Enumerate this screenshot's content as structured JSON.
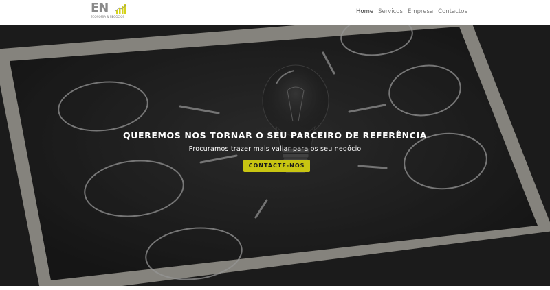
{
  "brand": {
    "logo_text": "EN",
    "logo_tagline": "ECONOMIA & NEGÓCIOS",
    "logo_subtagline": "",
    "colors": {
      "logo_gray": "#8a8a8a",
      "logo_accent": "#d4d21a"
    }
  },
  "nav": {
    "items": [
      {
        "label": "Home",
        "active": true
      },
      {
        "label": "Serviços",
        "active": false
      },
      {
        "label": "Empresa",
        "active": false
      },
      {
        "label": "Contactos",
        "active": false
      }
    ]
  },
  "hero": {
    "headline": "QUEREMOS NOS TORNAR O SEU PARCEIRO DE REFERÊNCIA",
    "subheadline": "Procuramos trazer mais valiar para os seu negócio",
    "cta_label": "CONTACTE-NOS",
    "background_description_icon": "lightbulb-chalkboard-image",
    "colors": {
      "cta_bg": "#c8c512",
      "cta_text": "#1a1a1a",
      "text": "#ffffff"
    }
  }
}
